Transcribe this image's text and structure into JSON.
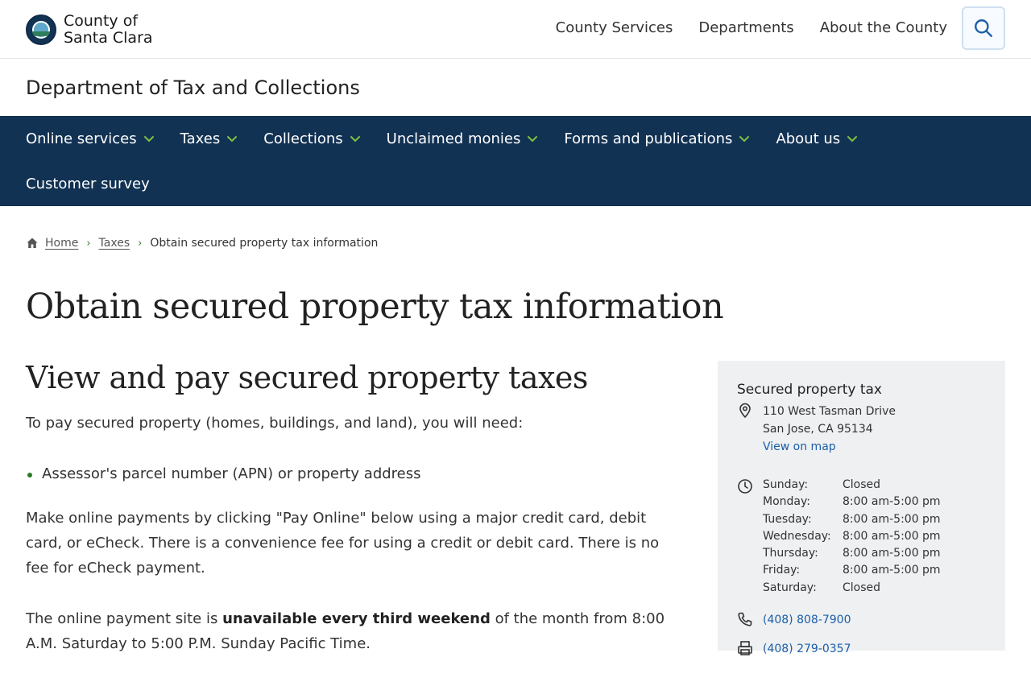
{
  "logo": {
    "line1": "County of",
    "line2": "Santa Clara"
  },
  "topnav": [
    "County Services",
    "Departments",
    "About the County"
  ],
  "department": "Department of Tax and Collections",
  "mainnav": {
    "row1": [
      "Online services",
      "Taxes",
      "Collections",
      "Unclaimed monies",
      "Forms and publications",
      "About us"
    ],
    "row2": [
      "Customer survey"
    ]
  },
  "breadcrumb": {
    "home": "Home",
    "section": "Taxes",
    "current": "Obtain secured property tax information"
  },
  "page_title": "Obtain secured property tax information",
  "section": {
    "title": "View and pay secured property taxes",
    "intro": "To pay secured property (homes, buildings, and land), you will need:",
    "bullets": [
      "Assessor's parcel number (APN) or property address"
    ],
    "para1": "Make online payments by clicking \"Pay Online\" below using a major credit card, debit card, or eCheck. There is a convenience fee for using a credit or debit card. There is no fee for eCheck payment.",
    "para2_before": "The online payment site is ",
    "para2_bold": "unavailable every third weekend",
    "para2_after": " of the month from 8:00 A.M. Saturday to 5:00 P.M. Sunday Pacific Time."
  },
  "card": {
    "title": "Secured property tax",
    "address_line1": "110 West Tasman Drive",
    "address_line2": "San Jose, CA 95134",
    "map_link": "View on map",
    "hours": [
      {
        "day": "Sunday:",
        "time": "Closed"
      },
      {
        "day": "Monday:",
        "time": "8:00 am-5:00 pm"
      },
      {
        "day": "Tuesday:",
        "time": "8:00 am-5:00 pm"
      },
      {
        "day": "Wednesday:",
        "time": "8:00 am-5:00 pm"
      },
      {
        "day": "Thursday:",
        "time": "8:00 am-5:00 pm"
      },
      {
        "day": "Friday:",
        "time": "8:00 am-5:00 pm"
      },
      {
        "day": "Saturday:",
        "time": "Closed"
      }
    ],
    "phone": "(408) 808-7900",
    "fax": "(408) 279-0357"
  },
  "colors": {
    "nav_bg": "#123254",
    "accent_green": "#7fc241",
    "link": "#1b5fa8",
    "card_bg": "#eef0f2"
  },
  "icons": [
    "seal-logo",
    "search-icon",
    "chevron-down-icon",
    "home-icon",
    "map-pin-icon",
    "clock-icon",
    "phone-icon",
    "fax-icon"
  ]
}
